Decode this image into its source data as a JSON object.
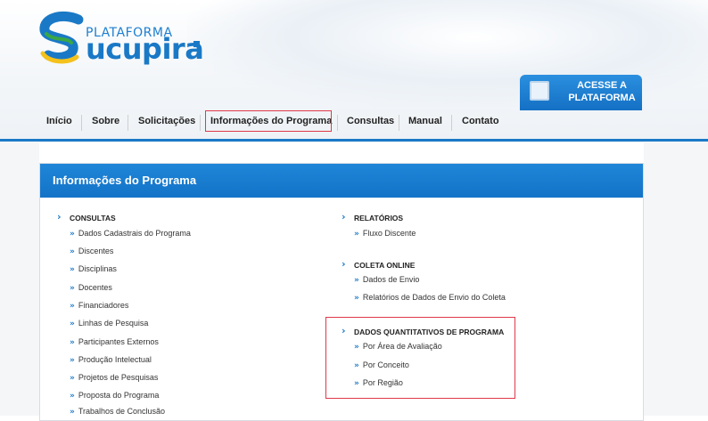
{
  "header": {
    "logo_small": "PLATAFORMA",
    "logo_big": "ucupira",
    "access_button": "ACESSE A PLATAFORMA"
  },
  "nav": {
    "items": [
      "Início",
      "Sobre",
      "Solicitações",
      "Informações do Programa",
      "Consultas",
      "Manual",
      "Contato"
    ],
    "active": "Informações do Programa"
  },
  "panel": {
    "title": "Informações do Programa",
    "sections": {
      "consultas": {
        "title": "CONSULTAS",
        "links": [
          "Dados Cadastrais do Programa",
          "Discentes",
          "Disciplinas",
          "Docentes",
          "Financiadores",
          "Linhas de Pesquisa",
          "Participantes Externos",
          "Produção Intelectual",
          "Projetos de Pesquisas",
          "Proposta do Programa",
          "Trabalhos de Conclusão"
        ]
      },
      "relatorios": {
        "title": "RELATÓRIOS",
        "links": [
          "Fluxo Discente"
        ]
      },
      "coleta": {
        "title": "COLETA ONLINE",
        "links": [
          "Dados de Envio",
          "Relatórios de Dados de Envio do Coleta"
        ]
      },
      "quantitativos": {
        "title": "DADOS QUANTITATIVOS DE PROGRAMA",
        "links": [
          "Por Área de Avaliação",
          "Por Conceito",
          "Por Região"
        ]
      }
    }
  },
  "icons": {
    "chevron": "›",
    "double_chevron": "»"
  },
  "colors": {
    "brand_blue": "#1a79c6",
    "highlight_red": "#e0394a",
    "logo_yellow": "#f4c21b",
    "logo_green": "#3aa745"
  }
}
